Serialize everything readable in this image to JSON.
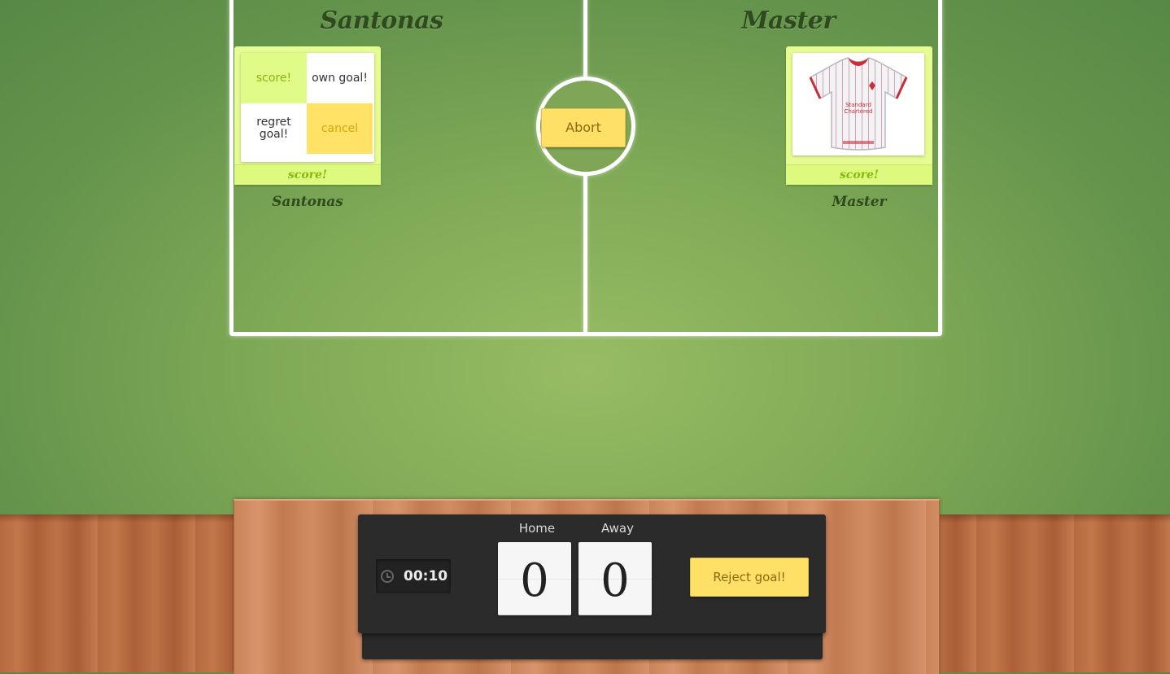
{
  "teams": {
    "home": {
      "title": "Santonas",
      "player_name": "Santonas",
      "footer_label": "score!",
      "actions": {
        "score": "score!",
        "own_goal": "own goal!",
        "regret_goal": "regret goal!",
        "cancel": "cancel"
      }
    },
    "away": {
      "title": "Master",
      "player_name": "Master",
      "footer_label": "score!"
    }
  },
  "center": {
    "abort_label": "Abort"
  },
  "scoreboard": {
    "timer": "00:10",
    "home_label": "Home",
    "away_label": "Away",
    "home_score": "0",
    "away_score": "0",
    "reject_label": "Reject goal!"
  },
  "colors": {
    "accent_yellow": "#ffe066",
    "score_green": "#86b80f",
    "card_bg": "#e6fb92"
  }
}
